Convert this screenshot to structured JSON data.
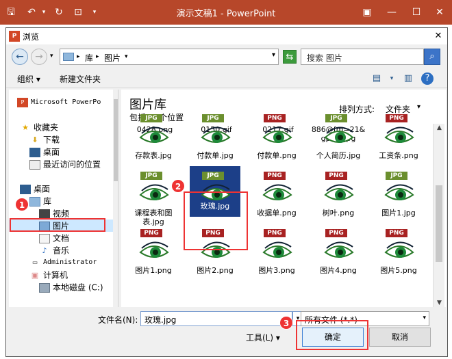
{
  "app": {
    "window_title": "演示文稿1 - PowerPoint"
  },
  "dialog": {
    "title": "浏览",
    "badge": "P"
  },
  "address": {
    "crumbs": [
      "库",
      "图片"
    ],
    "separator": "▸",
    "search_placeholder": "搜索 图片"
  },
  "toolbar": {
    "organize": "组织",
    "new_folder": "新建文件夹"
  },
  "nav": {
    "items": [
      {
        "label": "Microsoft PowerPo"
      },
      {
        "label": "收藏夹"
      },
      {
        "label": "下载"
      },
      {
        "label": "桌面"
      },
      {
        "label": "最近访问的位置"
      },
      {
        "label": "桌面"
      },
      {
        "label": "库"
      },
      {
        "label": "视频"
      },
      {
        "label": "图片"
      },
      {
        "label": "文档"
      },
      {
        "label": "音乐"
      },
      {
        "label": "Administrator"
      },
      {
        "label": "计算机"
      },
      {
        "label": "本地磁盘 (C:)"
      }
    ]
  },
  "content": {
    "library_title": "图片库",
    "library_sub": "包括: 2 个位置",
    "sort_label": "排列方式:",
    "sort_value": "文件夹",
    "partial_names": [
      "0428.png",
      "0150.gif",
      "0217.gif",
      "886@fm=21&\ngp=0.jpg"
    ],
    "files": [
      {
        "type": "JPG",
        "name": "存款表.jpg"
      },
      {
        "type": "JPG",
        "name": "付款单.jpg"
      },
      {
        "type": "PNG",
        "name": "付款单.png"
      },
      {
        "type": "JPG",
        "name": "个人简历.jpg"
      },
      {
        "type": "PNG",
        "name": "工资条.png"
      },
      {
        "type": "JPG",
        "name": "课程表和图表.jpg"
      },
      {
        "type": "JPG",
        "name": "玫瑰.jpg"
      },
      {
        "type": "PNG",
        "name": "收据单.png"
      },
      {
        "type": "PNG",
        "name": "树叶.png"
      },
      {
        "type": "JPG",
        "name": "图片1.jpg"
      },
      {
        "type": "PNG",
        "name": "图片1.png"
      },
      {
        "type": "PNG",
        "name": "图片2.png"
      },
      {
        "type": "PNG",
        "name": "图片3.png"
      },
      {
        "type": "PNG",
        "name": "图片4.png"
      },
      {
        "type": "PNG",
        "name": "图片5.png"
      }
    ]
  },
  "bottom": {
    "filename_label": "文件名(N):",
    "filename_value": "玫瑰.jpg",
    "filetype_value": "所有文件 (*.*)",
    "tools": "工具(L)",
    "ok": "确定",
    "cancel": "取消"
  },
  "steps": [
    "1",
    "2",
    "3"
  ],
  "colors": {
    "ppt_brand": "#b7472a",
    "selection": "#1c3f88",
    "annotation_red": "#e33333"
  }
}
